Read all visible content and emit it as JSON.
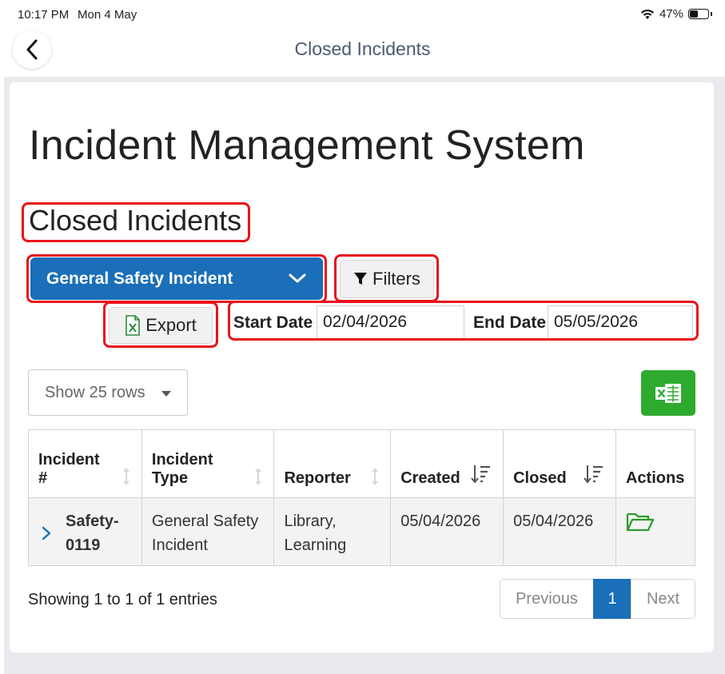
{
  "status_bar": {
    "time": "10:17 PM",
    "date": "Mon 4 May",
    "battery": "47%",
    "battery_level": 0.47
  },
  "nav": {
    "title": "Closed Incidents"
  },
  "app": {
    "title": "Incident Management System",
    "section_title": "Closed Incidents"
  },
  "filters": {
    "incident_type": "General Safety Incident",
    "filters_label": "Filters",
    "export_label": "Export",
    "start_date_label": "Start Date",
    "start_date": "02/04/2026",
    "end_date_label": "End Date",
    "end_date": "05/05/2026"
  },
  "table_controls": {
    "rows_select": "Show 25 rows"
  },
  "table": {
    "headers": {
      "incident_1": "Incident",
      "incident_2": "#",
      "type_1": "Incident",
      "type_2": "Type",
      "reporter": "Reporter",
      "created": "Created",
      "closed": "Closed",
      "actions": "Actions"
    },
    "rows": [
      {
        "id_1": "Safety-",
        "id_2": "0119",
        "type_1": "General Safety",
        "type_2": "Incident",
        "reporter_1": "Library,",
        "reporter_2": "Learning",
        "created": "05/04/2026",
        "closed": "05/04/2026"
      }
    ]
  },
  "footer": {
    "info": "Showing 1 to 1 of 1 entries",
    "previous": "Previous",
    "page": "1",
    "next": "Next"
  },
  "colors": {
    "primary": "#1a6fb8",
    "highlight": "#e8131b",
    "excel": "#2eaa2e",
    "folder": "#2a9a2a"
  }
}
